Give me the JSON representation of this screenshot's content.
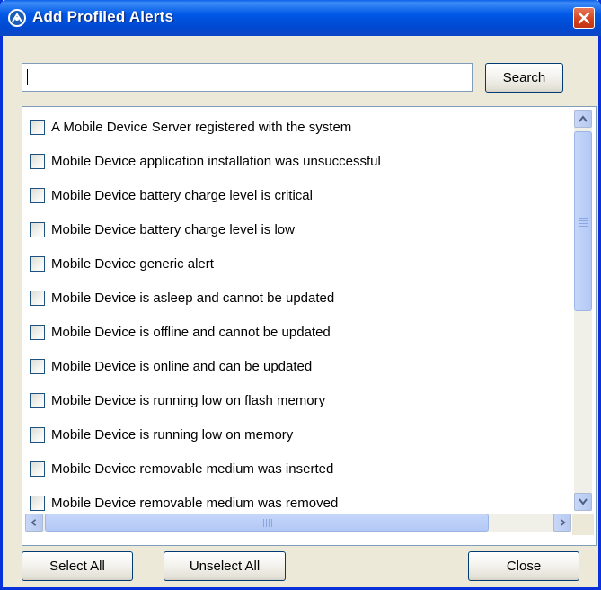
{
  "window": {
    "title": "Add Profiled Alerts",
    "icon": "app-logo-icon",
    "close_icon": "close-icon",
    "titlebar_color": "#0058e6",
    "close_color": "#d3401c"
  },
  "search": {
    "value": "",
    "placeholder": "",
    "button_label": "Search"
  },
  "alerts": {
    "items": [
      {
        "label": "A Mobile Device Server registered with the system",
        "checked": false
      },
      {
        "label": "Mobile Device application installation was unsuccessful",
        "checked": false
      },
      {
        "label": "Mobile Device battery charge level is critical",
        "checked": false
      },
      {
        "label": "Mobile Device battery charge level is low",
        "checked": false
      },
      {
        "label": "Mobile Device generic alert",
        "checked": false
      },
      {
        "label": "Mobile Device is asleep and cannot be updated",
        "checked": false
      },
      {
        "label": "Mobile Device is offline and cannot be updated",
        "checked": false
      },
      {
        "label": "Mobile Device is online and can be updated",
        "checked": false
      },
      {
        "label": "Mobile Device is running low on flash memory",
        "checked": false
      },
      {
        "label": "Mobile Device is running low on memory",
        "checked": false
      },
      {
        "label": "Mobile Device removable medium was inserted",
        "checked": false
      },
      {
        "label": "Mobile Device removable medium was removed",
        "checked": false
      }
    ]
  },
  "footer": {
    "select_all_label": "Select All",
    "unselect_all_label": "Unselect All",
    "close_label": "Close"
  }
}
